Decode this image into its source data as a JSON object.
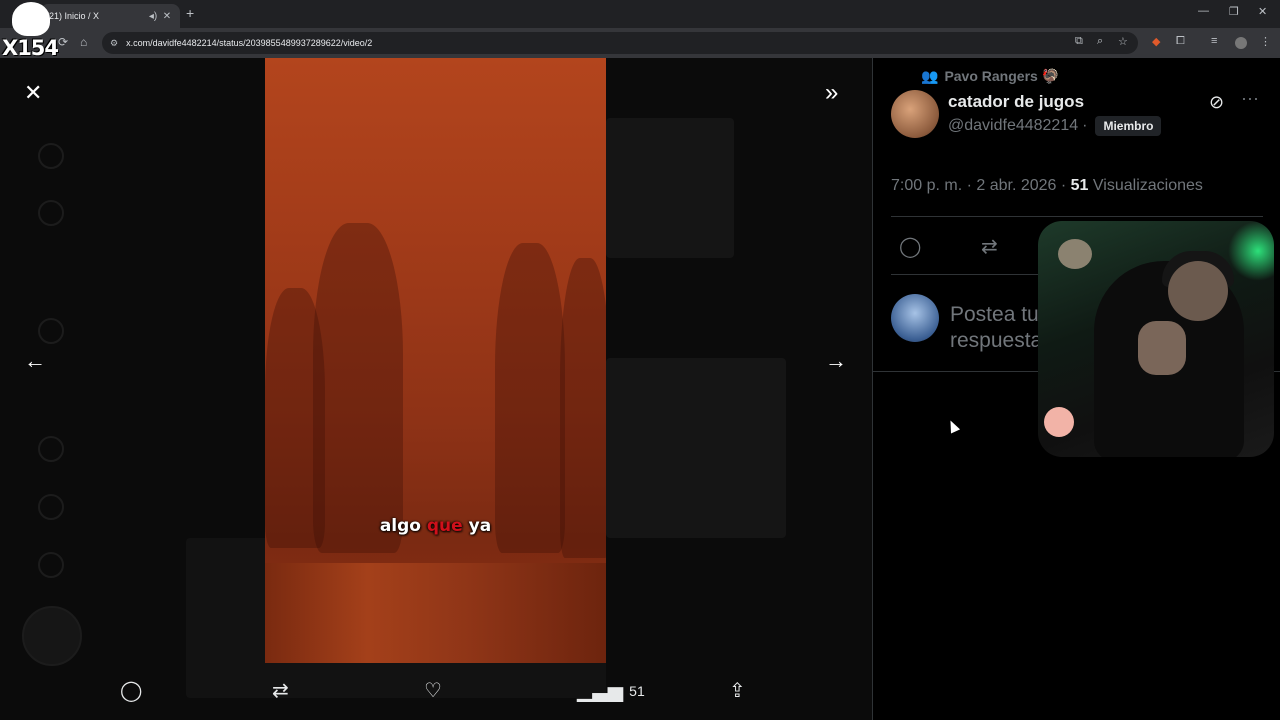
{
  "browser": {
    "tab_title": "(21) Inicio / X",
    "url": "x.com/davidfe4482214/status/2039855489937289622/video/2",
    "overlay_watermark": "X154"
  },
  "viewer": {
    "caption": {
      "pre": "algo ",
      "highlight": "que",
      "post": " ya"
    },
    "actions": {
      "views_count": "51"
    }
  },
  "post": {
    "community": "Pavo Rangers 🦃",
    "author_name": "catador de jugos",
    "handle": "@davidfe4482214",
    "separator": "·",
    "badge": "Miembro",
    "time": "7:00 p. m. · 2 abr. 2026 · ",
    "views_number": "51",
    "views_label": " Visualizaciones",
    "reply_placeholder": "Postea tu respuesta"
  },
  "colors": {
    "accent_red": "#d0101a",
    "muted": "#71767b",
    "text": "#e7e9ea"
  }
}
